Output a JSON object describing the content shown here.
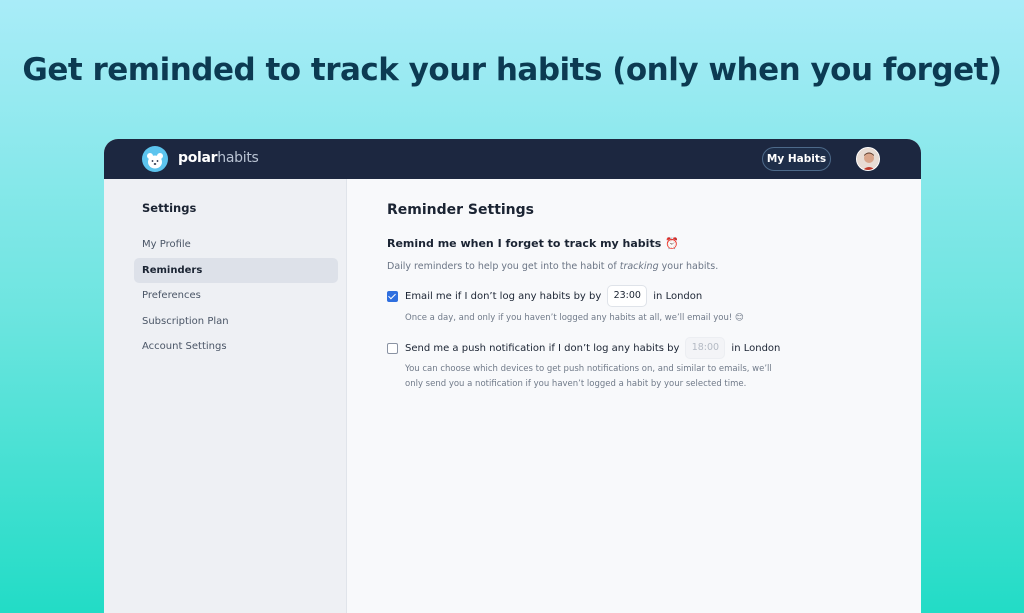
{
  "headline": "Get reminded to track your habits (only when you forget)",
  "header": {
    "brand_bold": "polar",
    "brand_light": "habits",
    "my_habits_label": "My Habits"
  },
  "sidebar": {
    "title": "Settings",
    "items": [
      {
        "label": "My Profile",
        "active": false
      },
      {
        "label": "Reminders",
        "active": true
      },
      {
        "label": "Preferences",
        "active": false
      },
      {
        "label": "Subscription Plan",
        "active": false
      },
      {
        "label": "Account Settings",
        "active": false
      }
    ]
  },
  "main": {
    "title": "Reminder Settings",
    "section_title": "Remind me when I forget to track my habits ⏰",
    "section_desc_pre": "Daily reminders to help you get into the habit of ",
    "section_desc_em": "tracking",
    "section_desc_post": " your habits.",
    "email": {
      "checked": true,
      "label_pre": "Email me if I don’t log any habits by by",
      "time_value": "23:00",
      "label_post": "in London",
      "hint": "Once a day, and only if you haven’t logged any habits at all, we’ll email you! 😊"
    },
    "push": {
      "checked": false,
      "label_pre": "Send me a push notification if I don’t log any habits by",
      "time_value": "18:00",
      "label_post": "in London",
      "hint": "You can choose which devices to get push notifications on, and similar to emails, we’ll only send you a notification if you haven’t logged a habit by your selected time."
    }
  },
  "colors": {
    "topbar": "#1c2740",
    "accent": "#2f6fdf",
    "headline": "#0c3a52"
  }
}
